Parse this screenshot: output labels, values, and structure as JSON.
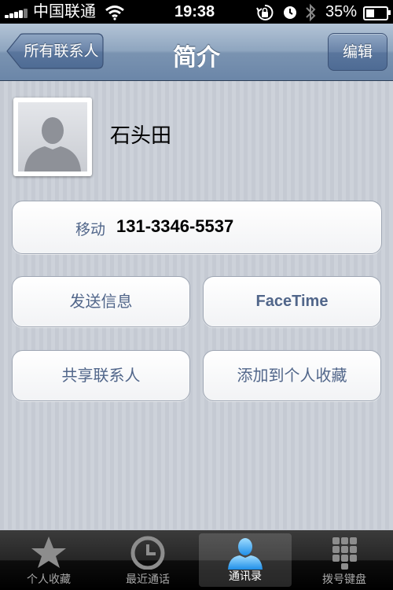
{
  "status_bar": {
    "carrier": "中国联通",
    "time": "19:38",
    "battery": "35%"
  },
  "nav": {
    "back_label": "所有联系人",
    "title": "简介",
    "edit_label": "编辑"
  },
  "contact": {
    "name": "石头田",
    "phone_label": "移动",
    "phone_number": "131-3346-5537"
  },
  "actions": {
    "send_message": "发送信息",
    "facetime": "FaceTime",
    "share_contact": "共享联系人",
    "add_favorite": "添加到个人收藏"
  },
  "tabbar": {
    "tabs": [
      {
        "label": "个人收藏",
        "icon": "star-icon"
      },
      {
        "label": "最近通话",
        "icon": "clock-icon"
      },
      {
        "label": "通讯录",
        "icon": "contacts-icon"
      },
      {
        "label": "拨号键盘",
        "icon": "keypad-icon"
      }
    ],
    "active_index": 2
  },
  "colors": {
    "accent_text": "#51668a",
    "nav_blue": "#6b86a8",
    "active_tab": "#39a6f5"
  }
}
